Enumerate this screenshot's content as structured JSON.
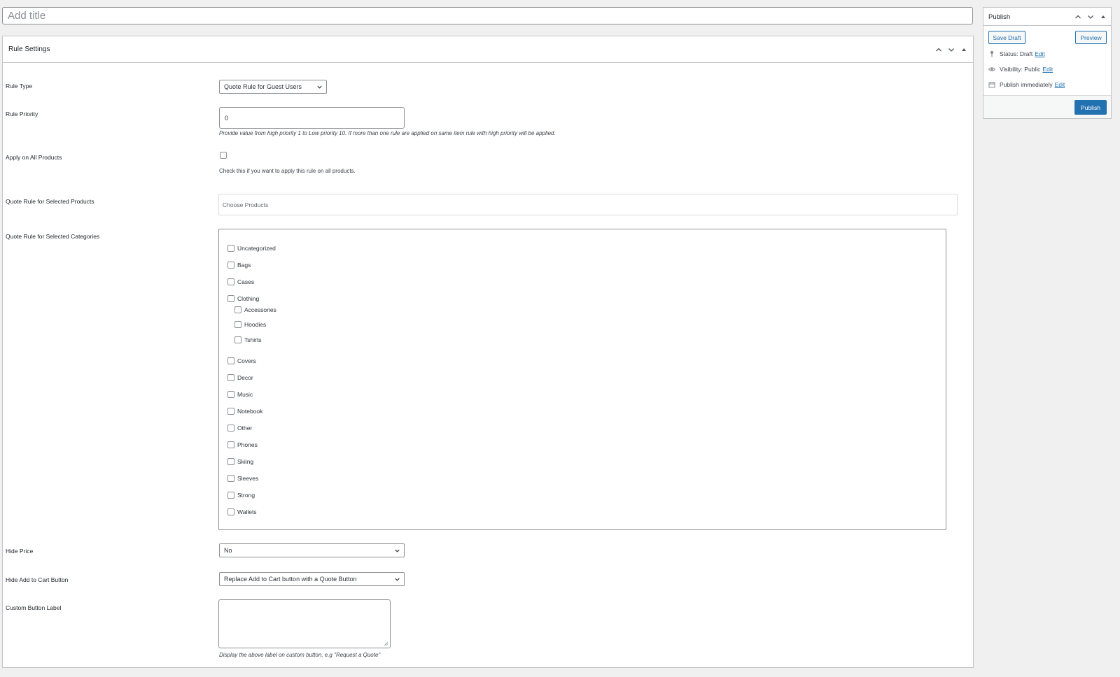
{
  "title": {
    "placeholder": "Add title"
  },
  "rule_settings": {
    "heading": "Rule Settings",
    "rule_type": {
      "label": "Rule Type",
      "value": "Quote Rule for Guest Users"
    },
    "rule_priority": {
      "label": "Rule Priority",
      "value": "0",
      "description": "Provide value from high priority 1 to Low priority 10. If more than one rule are applied on same item rule with high priority will be applied."
    },
    "apply_all": {
      "label": "Apply on All Products",
      "description": "Check this if you want to apply this rule on all products."
    },
    "selected_products": {
      "label": "Quote Rule for Selected Products",
      "placeholder": "Choose Products"
    },
    "selected_categories": {
      "label": "Quote Rule for Selected Categories",
      "items": [
        {
          "label": "Uncategorized",
          "level": 0
        },
        {
          "label": "Bags",
          "level": 0
        },
        {
          "label": "Cases",
          "level": 0
        },
        {
          "label": "Clothing",
          "level": 0
        },
        {
          "label": "Accessories",
          "level": 1
        },
        {
          "label": "Hoodies",
          "level": 1
        },
        {
          "label": "Tshirts",
          "level": 1
        },
        {
          "label": "Covers",
          "level": 0
        },
        {
          "label": "Decor",
          "level": 0
        },
        {
          "label": "Music",
          "level": 0
        },
        {
          "label": "Notebook",
          "level": 0
        },
        {
          "label": "Other",
          "level": 0
        },
        {
          "label": "Phones",
          "level": 0
        },
        {
          "label": "Skiing",
          "level": 0
        },
        {
          "label": "Sleeves",
          "level": 0
        },
        {
          "label": "Strong",
          "level": 0
        },
        {
          "label": "Wallets",
          "level": 0
        }
      ]
    },
    "hide_price": {
      "label": "Hide Price",
      "value": "No"
    },
    "hide_cart": {
      "label": "Hide Add to Cart Button",
      "value": "Replace Add to Cart button with a Quote Button"
    },
    "custom_label": {
      "label": "Custom Button Label",
      "value": "",
      "description": "Display the above label on custom button, e.g \"Request a Quote\""
    }
  },
  "publish": {
    "heading": "Publish",
    "save_draft": "Save Draft",
    "preview": "Preview",
    "status_text": "Status: Draft",
    "visibility_text": "Visibility: Public",
    "schedule_text": "Publish immediately",
    "edit_link": "Edit",
    "publish_button": "Publish"
  },
  "colors": {
    "accent": "#2271b1",
    "border": "#c3c4c7",
    "background": "#f0f0f1"
  },
  "icons": [
    "chevron-up-icon",
    "chevron-down-icon",
    "triangle-up-icon",
    "pin-icon",
    "eye-icon",
    "calendar-icon"
  ]
}
